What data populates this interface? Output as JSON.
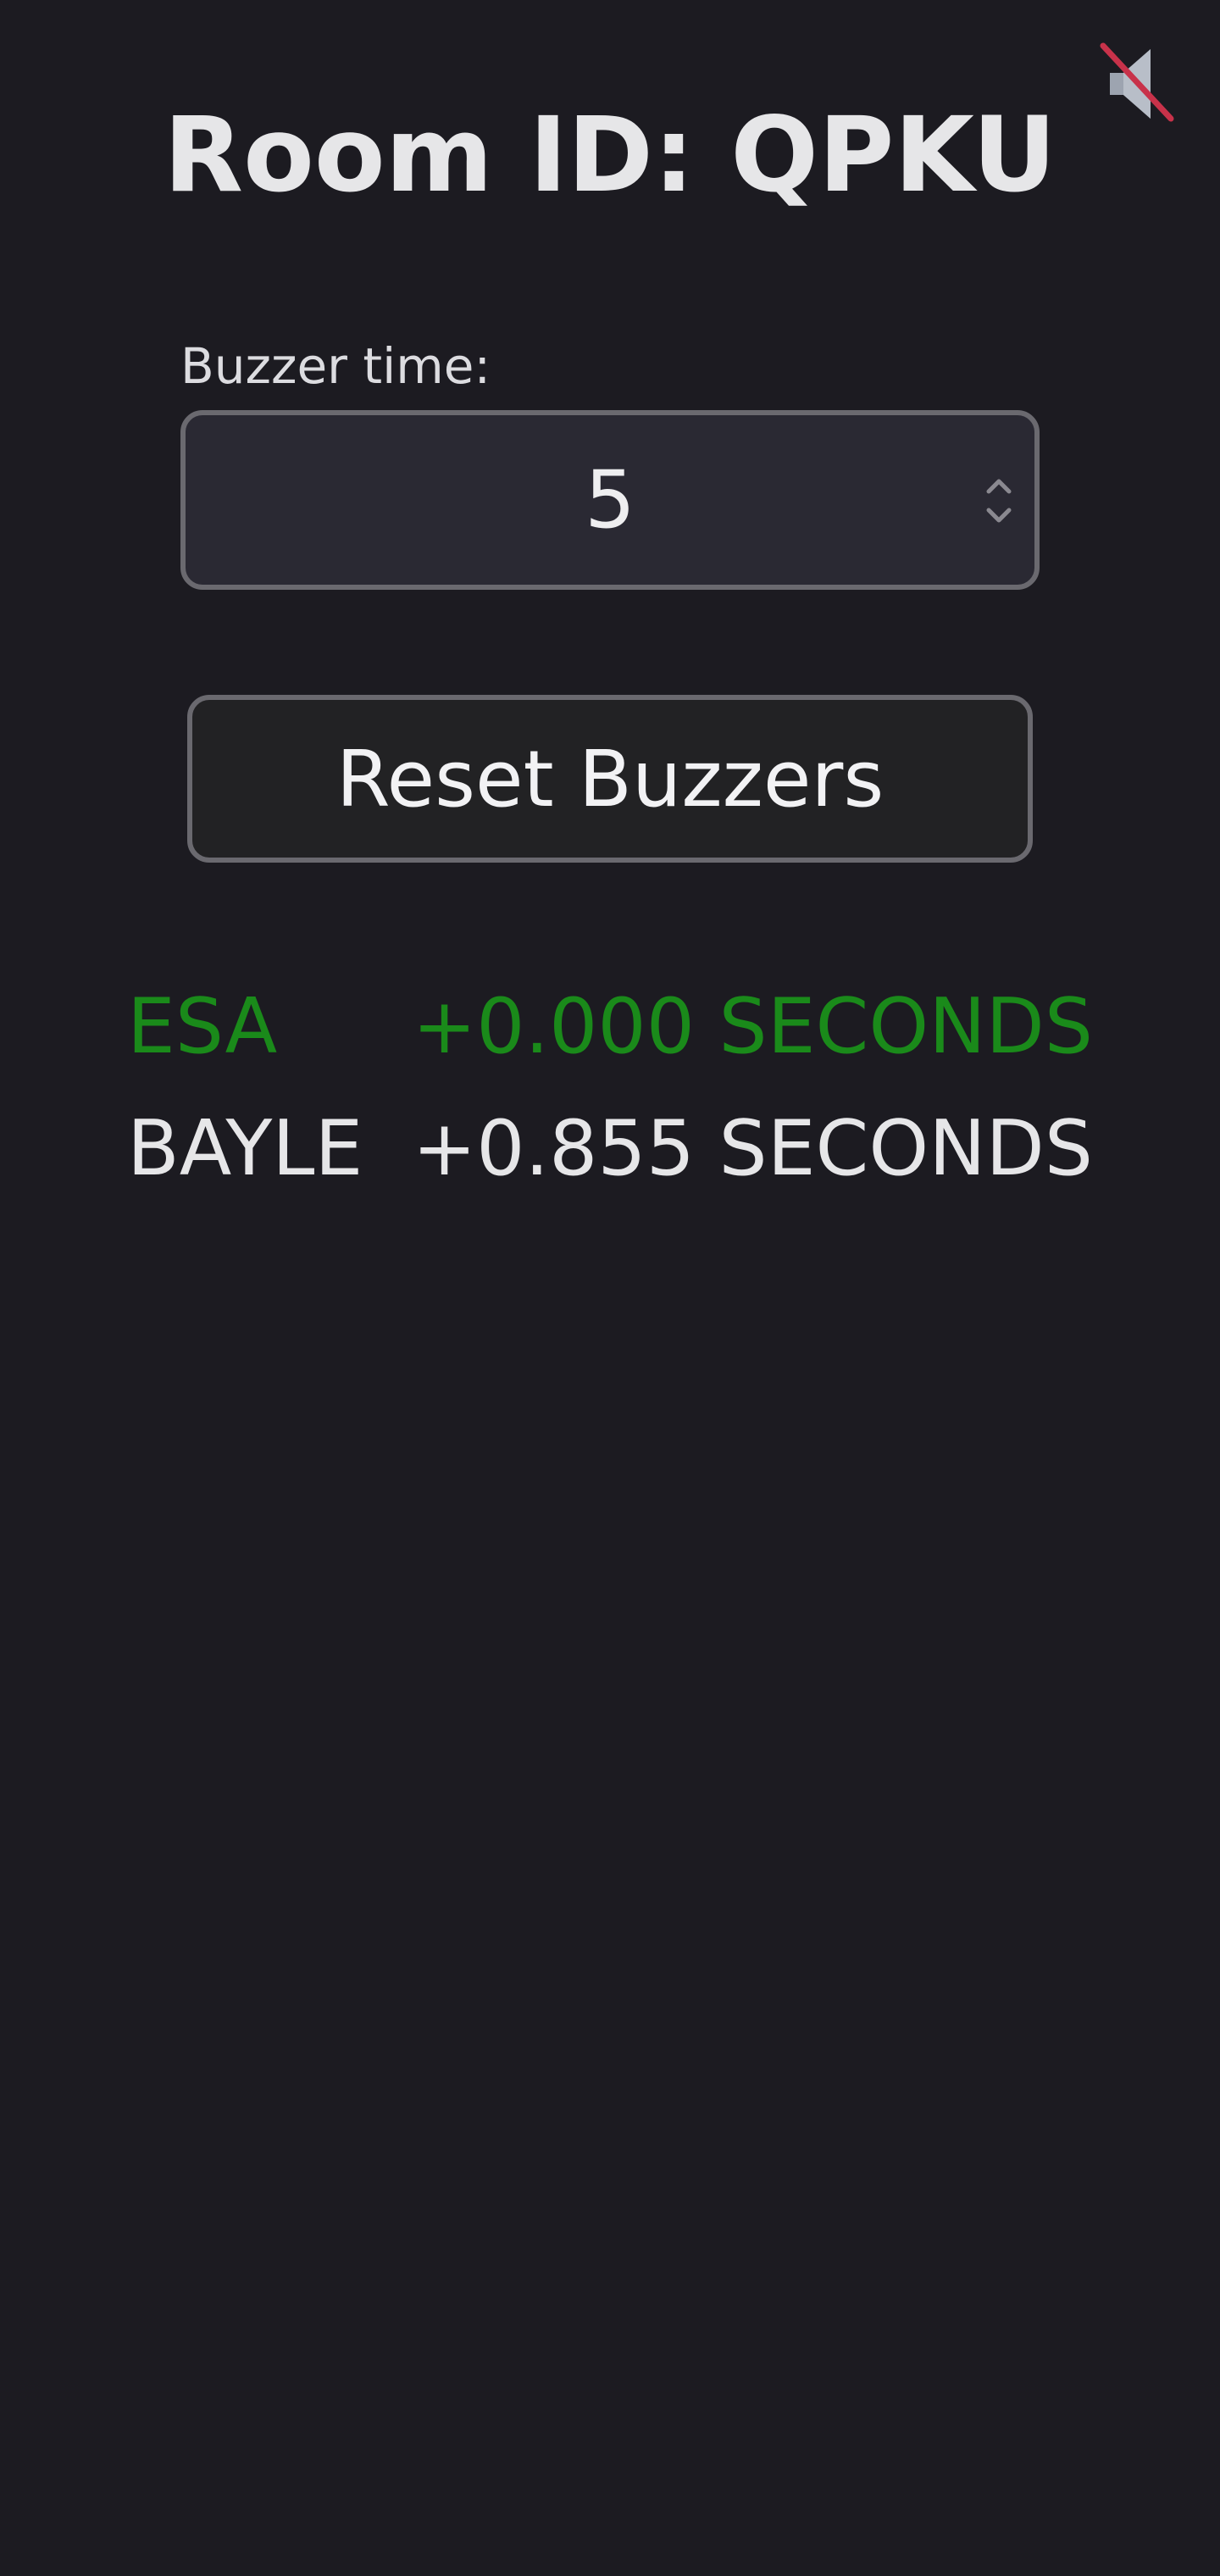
{
  "header": {
    "title": "Room ID: QPKU",
    "mute_icon": "speaker-muted-icon"
  },
  "buzzer_time": {
    "label": "Buzzer time:",
    "value": "5"
  },
  "reset_button": {
    "label": "Reset Buzzers"
  },
  "results": [
    {
      "name": "ESA",
      "time": "+0.000 SECONDS",
      "color": "#1a8a1a"
    },
    {
      "name": "BAYLE",
      "time": "+0.855 SECONDS",
      "color": "#e6e6e8"
    }
  ],
  "colors": {
    "background": "#1c1b21",
    "first_place": "#1a8a1a",
    "text": "#e6e6e8",
    "mute_slash": "#c8324a"
  }
}
